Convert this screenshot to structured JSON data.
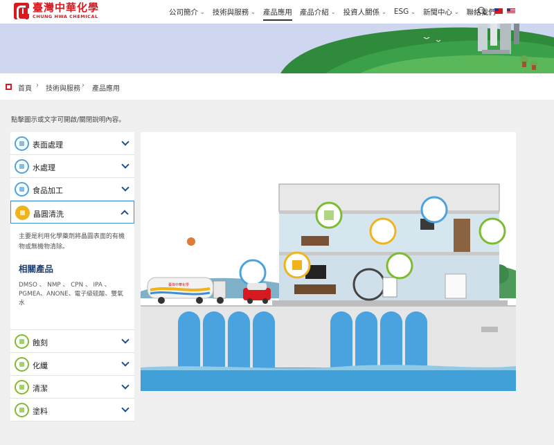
{
  "brand": {
    "name_cn": "臺灣中華化學",
    "name_en": "CHUNG HWA CHEMICAL",
    "color": "#d71920"
  },
  "nav": {
    "items": [
      {
        "label": "公司簡介",
        "has_dropdown": true
      },
      {
        "label": "技術與服務",
        "has_dropdown": true
      },
      {
        "label": "產品應用",
        "has_dropdown": false,
        "active": true
      },
      {
        "label": "產品介紹",
        "has_dropdown": true
      },
      {
        "label": "投資人關係",
        "has_dropdown": true
      },
      {
        "label": "ESG",
        "has_dropdown": true
      },
      {
        "label": "新聞中心",
        "has_dropdown": true
      },
      {
        "label": "聯絡我們",
        "has_dropdown": false
      }
    ],
    "dropdown_glyph": "⌄",
    "icons": [
      "search-icon",
      "taiwan-flag-icon",
      "us-flag-icon"
    ]
  },
  "breadcrumb": {
    "items": [
      "首頁",
      "技術與服務",
      "產品應用"
    ],
    "separator": "›"
  },
  "instruction": "點擊圖示或文字可開啟/關閉說明內容。",
  "accordion": {
    "items": [
      {
        "label": "表面處理",
        "icon": "surface-treatment-icon",
        "color": "#4aa3df",
        "open": false
      },
      {
        "label": "水處理",
        "icon": "water-treatment-icon",
        "color": "#4aa3df",
        "open": false
      },
      {
        "label": "食品加工",
        "icon": "food-processing-icon",
        "color": "#4aa3df",
        "open": false
      },
      {
        "label": "晶圓清洗",
        "icon": "wafer-cleaning-icon",
        "color": "#f0b31a",
        "open": true
      },
      {
        "label": "蝕刻",
        "icon": "etching-icon",
        "color": "#7dbb30",
        "open": false
      },
      {
        "label": "化纖",
        "icon": "chemical-fiber-icon",
        "color": "#7dbb30",
        "open": false
      },
      {
        "label": "清潔",
        "icon": "cleaning-spray-icon",
        "color": "#7dbb30",
        "open": false
      },
      {
        "label": "塗料",
        "icon": "paint-icon",
        "color": "#7dbb30",
        "open": false
      }
    ],
    "open_panel": {
      "description": "主要是利用化學藥劑將晶圓表面的有機物或無機物清除。",
      "subtitle": "相關產品",
      "products": "DMSO 、 NMP 、 CPN 、 IPA 、 PGMEA、ANONE、電子級硫酸、雙氧水"
    }
  },
  "illustration": {
    "truck_logo_text": "臺灣中華化學",
    "colors": {
      "sky": "#d4ecfa",
      "water": "#3f9fd6",
      "wall": "#e6e6e6",
      "accent_red": "#d71920"
    }
  }
}
